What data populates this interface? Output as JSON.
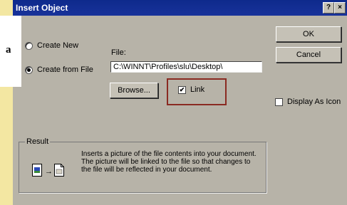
{
  "dialog": {
    "title": "Insert Object",
    "help_glyph": "?",
    "close_glyph": "×"
  },
  "side_letter": "a",
  "options": {
    "create_new": "Create New",
    "create_from_file": "Create from File",
    "selected": "create_from_file"
  },
  "file": {
    "label": "File:",
    "value": "C:\\WINNT\\Profiles\\slu\\Desktop\\"
  },
  "buttons": {
    "ok": "OK",
    "cancel": "Cancel",
    "browse": "Browse..."
  },
  "link": {
    "label": "Link",
    "checked": true,
    "check_glyph": "✔"
  },
  "display_as_icon": {
    "label": "Display As Icon",
    "checked": false
  },
  "result": {
    "label": "Result",
    "text": "Inserts a picture of the file contents into your document. The picture will be linked to the file so that changes to the file will be reflected in your document.",
    "arrow_glyph": "→"
  },
  "colors": {
    "title_bar": "#0e2a8c",
    "dialog_bg": "#b7b3a8",
    "highlight_box": "#8a2a22",
    "page_bg": "#f6efcf"
  }
}
